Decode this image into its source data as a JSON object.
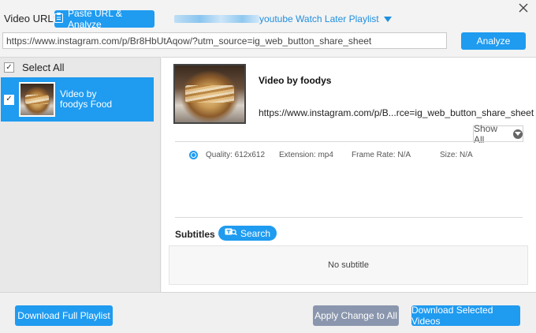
{
  "header": {
    "video_url_label": "Video URL:",
    "paste_button_label": "Paste URL & Analyze",
    "playlist_link": "youtube Watch Later Playlist",
    "url_value": "https://www.instagram.com/p/Br8HbUtAqow/?utm_source=ig_web_button_share_sheet",
    "analyze_label": "Analyze"
  },
  "sidebar": {
    "select_all_label": "Select All",
    "items": [
      {
        "title": "Video by foodys Food",
        "checked": true
      }
    ]
  },
  "detail": {
    "title": "Video by foodys",
    "url": "https://www.instagram.com/p/B...rce=ig_web_button_share_sheet",
    "show_all_label": "Show All",
    "formats": [
      {
        "quality": "Quality: 612x612",
        "extension": "Extension: mp4",
        "frame_rate": "Frame Rate: N/A",
        "size": "Size: N/A",
        "selected": true
      }
    ],
    "subtitles_label": "Subtitles",
    "search_label": "Search",
    "no_subtitle_text": "No subtitle"
  },
  "footer": {
    "download_playlist_label": "Download Full Playlist",
    "apply_label": "Apply Change to All",
    "download_selected_label": "Download Selected Videos"
  },
  "colors": {
    "accent": "#1f9bf0",
    "apply_button": "#8a96ad",
    "sidebar_bg": "#e8e8e8"
  }
}
